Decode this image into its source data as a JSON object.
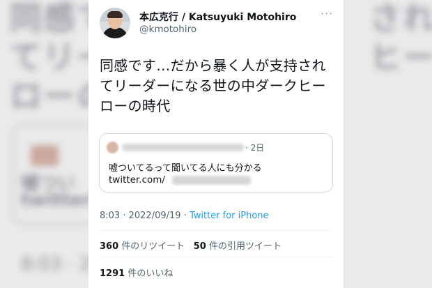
{
  "author": {
    "name": "本広克行 / Katsuyuki Motohiro",
    "handle": "@kmotohiro"
  },
  "menu_icon": "more-dots-icon",
  "tweet": {
    "line1": "同感です…だから暴く人が支持され",
    "line2": "てリーダーになる世の中ダークヒー",
    "line3": "ローの時代"
  },
  "quoted": {
    "time": "· 2日",
    "text": "嘘ついてるって聞いてる人にも分かる",
    "link_prefix": "twitter.com/"
  },
  "meta": {
    "time": "8:03",
    "sep": " · ",
    "date": "2022/09/19",
    "source": "Twitter for iPhone"
  },
  "stats": {
    "retweets": "360",
    "retweets_label": "件のリツイート",
    "quotes": "50",
    "quotes_label": "件の引用ツイート",
    "likes": "1291",
    "likes_label": "件のいいね"
  }
}
